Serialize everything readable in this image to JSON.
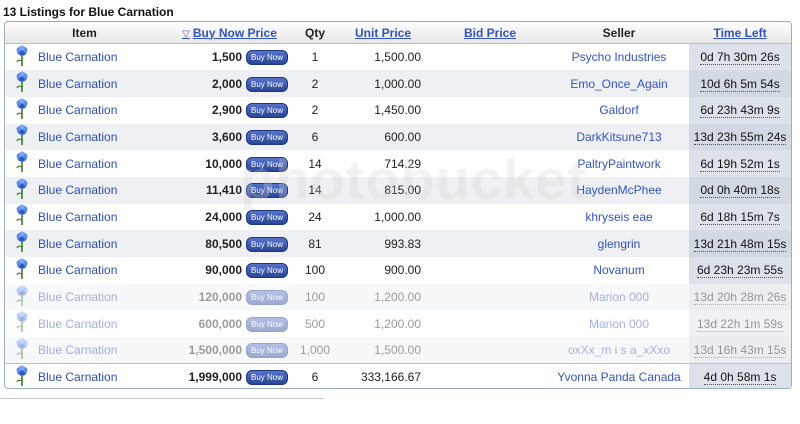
{
  "title": "13 Listings for Blue Carnation",
  "headers": {
    "item": "Item",
    "buy_now_price": "Buy Now Price",
    "qty": "Qty",
    "unit_price": "Unit Price",
    "bid_price": "Bid Price",
    "seller": "Seller",
    "time_left": "Time Left"
  },
  "buy_now_button_label": "Buy Now",
  "item_icon": "blue-carnation-flower-icon",
  "watermark": "photobucket",
  "accent_color": "#2e4fb3",
  "rows": [
    {
      "item": "Blue Carnation",
      "price": "1,500",
      "qty": "1",
      "unit": "1,500.00",
      "seller": "Psycho Industries",
      "time": "0d 7h 30m 26s",
      "faded": false
    },
    {
      "item": "Blue Carnation",
      "price": "2,000",
      "qty": "2",
      "unit": "1,000.00",
      "seller": "Emo_Once_Again",
      "time": "10d 6h 5m 54s",
      "faded": false
    },
    {
      "item": "Blue Carnation",
      "price": "2,900",
      "qty": "2",
      "unit": "1,450.00",
      "seller": "Galdorf",
      "time": "6d 23h 43m 9s",
      "faded": false
    },
    {
      "item": "Blue Carnation",
      "price": "3,600",
      "qty": "6",
      "unit": "600.00",
      "seller": "DarkKitsune713",
      "time": "13d 23h 55m 24s",
      "faded": false
    },
    {
      "item": "Blue Carnation",
      "price": "10,000",
      "qty": "14",
      "unit": "714.29",
      "seller": "PaltryPaintwork",
      "time": "6d 19h 52m 1s",
      "faded": false
    },
    {
      "item": "Blue Carnation",
      "price": "11,410",
      "qty": "14",
      "unit": "815.00",
      "seller": "HaydenMcPhee",
      "time": "0d 0h 40m 18s",
      "faded": false
    },
    {
      "item": "Blue Carnation",
      "price": "24,000",
      "qty": "24",
      "unit": "1,000.00",
      "seller": "khryseis eae",
      "time": "6d 18h 15m 7s",
      "faded": false
    },
    {
      "item": "Blue Carnation",
      "price": "80,500",
      "qty": "81",
      "unit": "993.83",
      "seller": "glengrin",
      "time": "13d 21h 48m 15s",
      "faded": false
    },
    {
      "item": "Blue Carnation",
      "price": "90,000",
      "qty": "100",
      "unit": "900.00",
      "seller": "Novanum",
      "time": "6d 23h 23m 55s",
      "faded": false
    },
    {
      "item": "Blue Carnation",
      "price": "120,000",
      "qty": "100",
      "unit": "1,200.00",
      "seller": "Marion 000",
      "time": "13d 20h 28m 26s",
      "faded": true
    },
    {
      "item": "Blue Carnation",
      "price": "600,000",
      "qty": "500",
      "unit": "1,200.00",
      "seller": "Marion 000",
      "time": "13d 22h 1m 59s",
      "faded": true
    },
    {
      "item": "Blue Carnation",
      "price": "1,500,000",
      "qty": "1,000",
      "unit": "1,500.00",
      "seller": "oxXx_m i s a_xXxo",
      "time": "13d 16h 43m 15s",
      "faded": true
    },
    {
      "item": "Blue Carnation",
      "price": "1,999,000",
      "qty": "6",
      "unit": "333,166.67",
      "seller": "Yvonna Panda Canada",
      "time": "4d 0h 58m 1s",
      "faded": false
    }
  ]
}
